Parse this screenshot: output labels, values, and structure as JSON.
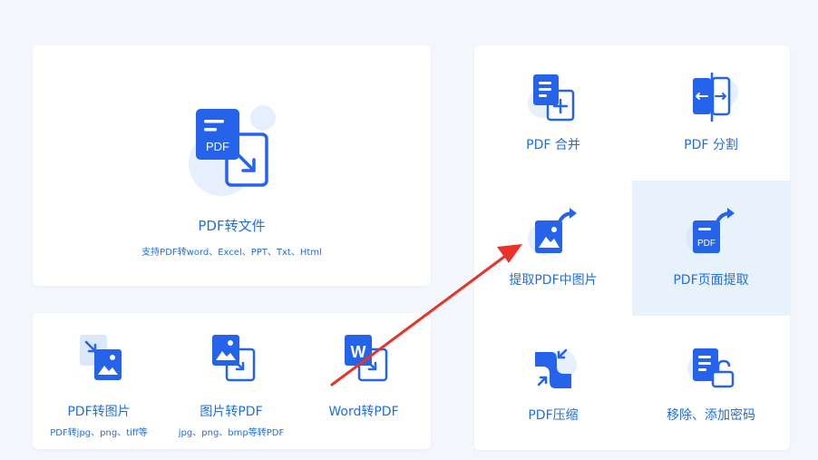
{
  "main_card": {
    "title": "PDF转文件",
    "description": "支持PDF转word、Excel、PPT、Txt、Html",
    "icon": "pdf-convert-file-icon",
    "icon_text": "PDF"
  },
  "bottom_tools": [
    {
      "label": "PDF转图片",
      "sub": "PDF转jpg、png、tiff等",
      "icon": "pdf-to-image-icon"
    },
    {
      "label": "图片转PDF",
      "sub": "jpg、png、bmp等转PDF",
      "icon": "image-to-pdf-icon"
    },
    {
      "label": "Word转PDF",
      "sub": "",
      "icon": "word-to-pdf-icon",
      "icon_text": "W"
    }
  ],
  "right_tools": [
    {
      "label": "PDF 合并",
      "icon": "pdf-merge-icon"
    },
    {
      "label": "PDF 分割",
      "icon": "pdf-split-icon"
    },
    {
      "label": "提取PDF中图片",
      "icon": "extract-images-icon"
    },
    {
      "label": "PDF页面提取",
      "icon": "extract-pages-icon",
      "icon_text": "PDF",
      "selected": true
    },
    {
      "label": "PDF压缩",
      "icon": "pdf-compress-icon"
    },
    {
      "label": "移除、添加密码",
      "icon": "password-lock-icon"
    }
  ],
  "colors": {
    "accent": "#1f6fe0",
    "icon_blue": "#2563eb",
    "icon_light": "#dbe7fb",
    "selected_bg": "#e8f2fd",
    "annotation_arrow": "#e8322a",
    "background": "#f3f6fa"
  }
}
